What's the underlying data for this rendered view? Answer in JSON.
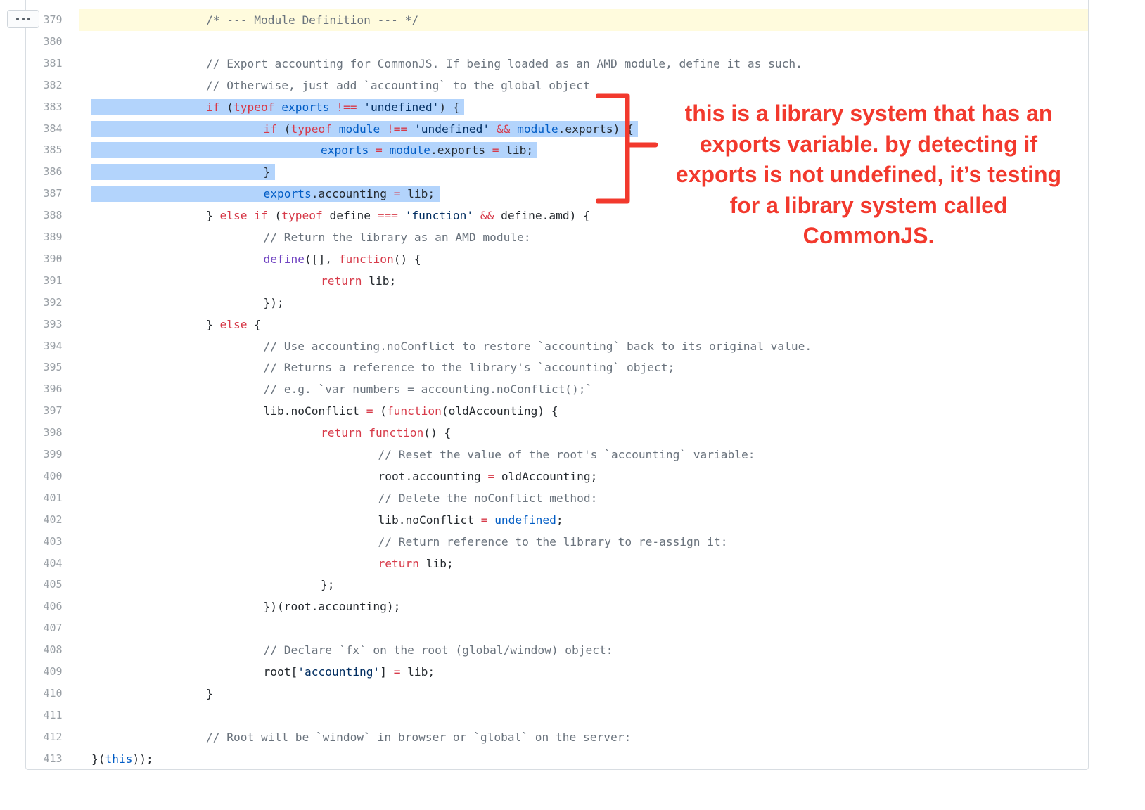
{
  "expander": {
    "icon": "ellipsis-icon"
  },
  "lines": [
    {
      "n": "379",
      "highlighted": true,
      "indent": 2,
      "t": [
        [
          "c-comment",
          "/* --- Module Definition --- */"
        ]
      ]
    },
    {
      "n": "380",
      "t": []
    },
    {
      "n": "381",
      "indent": 2,
      "t": [
        [
          "c-comment",
          "// Export accounting for CommonJS. If being loaded as an AMD module, define it as such."
        ]
      ]
    },
    {
      "n": "382",
      "indent": 2,
      "t": [
        [
          "c-comment",
          "// Otherwise, just add `accounting` to the global object"
        ]
      ]
    },
    {
      "n": "383",
      "indent": 2,
      "selected": true,
      "t": [
        [
          "c-kw",
          "if"
        ],
        [
          "",
          " ("
        ],
        [
          "c-kw",
          "typeof"
        ],
        [
          "",
          " "
        ],
        [
          "c-ent",
          "exports"
        ],
        [
          "",
          " "
        ],
        [
          "c-op",
          "!=="
        ],
        [
          "",
          " "
        ],
        [
          "c-str",
          "'undefined'"
        ],
        [
          "",
          ") {"
        ]
      ]
    },
    {
      "n": "384",
      "indent": 3,
      "selected": true,
      "t": [
        [
          "c-kw",
          "if"
        ],
        [
          "",
          " ("
        ],
        [
          "c-kw",
          "typeof"
        ],
        [
          "",
          " "
        ],
        [
          "c-ent",
          "module"
        ],
        [
          "",
          " "
        ],
        [
          "c-op",
          "!=="
        ],
        [
          "",
          " "
        ],
        [
          "c-str",
          "'undefined'"
        ],
        [
          "",
          " "
        ],
        [
          "c-op",
          "&&"
        ],
        [
          "",
          " "
        ],
        [
          "c-ent",
          "module"
        ],
        [
          "",
          ".exports) {"
        ]
      ]
    },
    {
      "n": "385",
      "indent": 4,
      "selected": true,
      "t": [
        [
          "c-ent",
          "exports"
        ],
        [
          "",
          " "
        ],
        [
          "c-op",
          "="
        ],
        [
          "",
          " "
        ],
        [
          "c-ent",
          "module"
        ],
        [
          "",
          ".exports "
        ],
        [
          "c-op",
          "="
        ],
        [
          "",
          " lib;"
        ]
      ]
    },
    {
      "n": "386",
      "indent": 3,
      "selected": true,
      "t": [
        [
          "",
          "}"
        ]
      ]
    },
    {
      "n": "387",
      "indent": 3,
      "selected": true,
      "t": [
        [
          "c-ent",
          "exports"
        ],
        [
          "",
          ".accounting "
        ],
        [
          "c-op",
          "="
        ],
        [
          "",
          " lib;"
        ]
      ]
    },
    {
      "n": "388",
      "indent": 2,
      "t": [
        [
          "",
          "} "
        ],
        [
          "c-kw",
          "else"
        ],
        [
          "",
          " "
        ],
        [
          "c-kw",
          "if"
        ],
        [
          "",
          " ("
        ],
        [
          "c-kw",
          "typeof"
        ],
        [
          "",
          " define "
        ],
        [
          "c-op",
          "==="
        ],
        [
          "",
          " "
        ],
        [
          "c-str",
          "'function'"
        ],
        [
          "",
          " "
        ],
        [
          "c-op",
          "&&"
        ],
        [
          "",
          " define.amd) {"
        ]
      ]
    },
    {
      "n": "389",
      "indent": 3,
      "t": [
        [
          "c-comment",
          "// Return the library as an AMD module:"
        ]
      ]
    },
    {
      "n": "390",
      "indent": 3,
      "t": [
        [
          "c-fn",
          "define"
        ],
        [
          "",
          "([], "
        ],
        [
          "c-kw",
          "function"
        ],
        [
          "",
          "() {"
        ]
      ]
    },
    {
      "n": "391",
      "indent": 4,
      "t": [
        [
          "c-kw",
          "return"
        ],
        [
          "",
          " lib;"
        ]
      ]
    },
    {
      "n": "392",
      "indent": 3,
      "t": [
        [
          "",
          "});"
        ]
      ]
    },
    {
      "n": "393",
      "indent": 2,
      "t": [
        [
          "",
          "} "
        ],
        [
          "c-kw",
          "else"
        ],
        [
          "",
          " {"
        ]
      ]
    },
    {
      "n": "394",
      "indent": 3,
      "t": [
        [
          "c-comment",
          "// Use accounting.noConflict to restore `accounting` back to its original value."
        ]
      ]
    },
    {
      "n": "395",
      "indent": 3,
      "t": [
        [
          "c-comment",
          "// Returns a reference to the library's `accounting` object;"
        ]
      ]
    },
    {
      "n": "396",
      "indent": 3,
      "t": [
        [
          "c-comment",
          "// e.g. `var numbers = accounting.noConflict();`"
        ]
      ]
    },
    {
      "n": "397",
      "indent": 3,
      "t": [
        [
          "",
          "lib.noConflict "
        ],
        [
          "c-op",
          "="
        ],
        [
          "",
          " ("
        ],
        [
          "c-kw",
          "function"
        ],
        [
          "",
          "(oldAccounting) {"
        ]
      ]
    },
    {
      "n": "398",
      "indent": 4,
      "t": [
        [
          "c-kw",
          "return"
        ],
        [
          "",
          " "
        ],
        [
          "c-kw",
          "function"
        ],
        [
          "",
          "() {"
        ]
      ]
    },
    {
      "n": "399",
      "indent": 5,
      "t": [
        [
          "c-comment",
          "// Reset the value of the root's `accounting` variable:"
        ]
      ]
    },
    {
      "n": "400",
      "indent": 5,
      "t": [
        [
          "",
          "root.accounting "
        ],
        [
          "c-op",
          "="
        ],
        [
          "",
          " oldAccounting;"
        ]
      ]
    },
    {
      "n": "401",
      "indent": 5,
      "t": [
        [
          "c-comment",
          "// Delete the noConflict method:"
        ]
      ]
    },
    {
      "n": "402",
      "indent": 5,
      "t": [
        [
          "",
          "lib.noConflict "
        ],
        [
          "c-op",
          "="
        ],
        [
          "",
          " "
        ],
        [
          "c-ent",
          "undefined"
        ],
        [
          "",
          ";"
        ]
      ]
    },
    {
      "n": "403",
      "indent": 5,
      "t": [
        [
          "c-comment",
          "// Return reference to the library to re-assign it:"
        ]
      ]
    },
    {
      "n": "404",
      "indent": 5,
      "t": [
        [
          "c-kw",
          "return"
        ],
        [
          "",
          " lib;"
        ]
      ]
    },
    {
      "n": "405",
      "indent": 4,
      "t": [
        [
          "",
          "};"
        ]
      ]
    },
    {
      "n": "406",
      "indent": 3,
      "t": [
        [
          "",
          "})(root.accounting);"
        ]
      ]
    },
    {
      "n": "407",
      "t": []
    },
    {
      "n": "408",
      "indent": 3,
      "t": [
        [
          "c-comment",
          "// Declare `fx` on the root (global/window) object:"
        ]
      ]
    },
    {
      "n": "409",
      "indent": 3,
      "t": [
        [
          "",
          "root["
        ],
        [
          "c-str",
          "'accounting'"
        ],
        [
          "",
          "] "
        ],
        [
          "c-op",
          "="
        ],
        [
          "",
          " lib;"
        ]
      ]
    },
    {
      "n": "410",
      "indent": 2,
      "t": [
        [
          "",
          "}"
        ]
      ]
    },
    {
      "n": "411",
      "t": []
    },
    {
      "n": "412",
      "indent": 2,
      "t": [
        [
          "c-comment",
          "// Root will be `window` in browser or `global` on the server:"
        ]
      ]
    },
    {
      "n": "413",
      "indent": 0,
      "t": [
        [
          "",
          "}("
        ],
        [
          "c-ent",
          "this"
        ],
        [
          "",
          "));"
        ]
      ]
    }
  ],
  "annotation": {
    "lines": [
      "this is a library system that has an",
      "exports variable. by detecting if",
      "exports is not undefined, it’s testing",
      "for a library system called",
      "CommonJS."
    ],
    "color": "#f2392d"
  },
  "colors": {
    "highlight_line": "#fffbdd",
    "selection": "#b3d4fc",
    "keyword": "#d73a49",
    "string": "#032f62",
    "entity": "#005cc5",
    "function": "#6f42c1",
    "comment": "#6a737d"
  }
}
